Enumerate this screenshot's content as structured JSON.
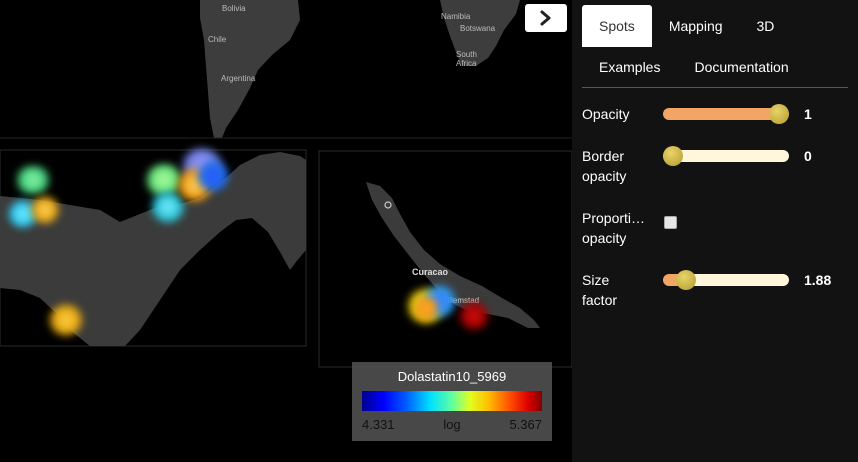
{
  "map": {
    "labels": {
      "bolivia": "Bolivia",
      "chile": "Chile",
      "argentina": "Argentina",
      "namibia": "Namibia",
      "botswana": "Botswana",
      "south_africa_1": "South",
      "south_africa_2": "Africa",
      "curacao": "Curacao",
      "willemstad": "Willemstad"
    },
    "toggle_icon": "chevron-right-icon"
  },
  "legend": {
    "title": "Dolastatin10_5969",
    "min": "4.331",
    "scale": "log",
    "max": "5.367",
    "colors": [
      "#00008f",
      "#0000ff",
      "#00e0ff",
      "#e0ff20",
      "#ff5000",
      "#800000"
    ]
  },
  "panel": {
    "tabs_row1": [
      "Spots",
      "Mapping",
      "3D"
    ],
    "tabs_row2": [
      "Examples",
      "Documentation"
    ],
    "active_tab": "Spots",
    "controls": {
      "opacity": {
        "label": "Opacity",
        "value": "1",
        "fraction": 1.0
      },
      "border_opacity": {
        "label_line1": "Border",
        "label_line2": "opacity",
        "value": "0",
        "fraction": 0.0
      },
      "proportional_opacity": {
        "label_line1": "Proporti…",
        "label_line2": "opacity",
        "checked": false
      },
      "size_factor": {
        "label_line1": "Size",
        "label_line2": "factor",
        "value": "1.88",
        "fraction": 0.18
      }
    }
  }
}
